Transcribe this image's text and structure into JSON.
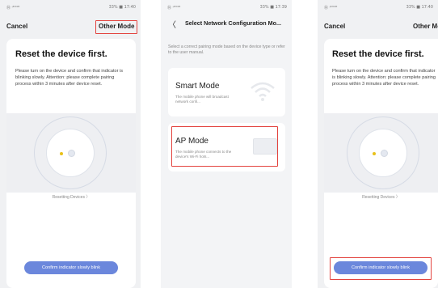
{
  "status": {
    "left": "Ⓝ ᵎ⁴ᴳ⁴ᴳ",
    "right_1": "33% ■ 17:40",
    "right_2": "33% ■ 17:39",
    "right_3": "33% ■ 17:40"
  },
  "reset_screen": {
    "cancel_label": "Cancel",
    "other_mode_label": "Other Mode",
    "title": "Reset the device first.",
    "description": "Please turn on the device and confirm that indicator is blinking slowly. Attention: please complete pairing process within 3 minutes after device reset.",
    "caption": "Resetting Devices 〉",
    "confirm_label": "Confirm indicator slowly blink"
  },
  "network_screen": {
    "back_label": "〈",
    "title": "Select Network Configuration Mo...",
    "hint": "Select a correct pairing mode based on the device type or refer to the user manual.",
    "smart_mode": {
      "title": "Smart Mode",
      "description": "The mobile phone will broadcast network confi..."
    },
    "ap_mode": {
      "title": "AP Mode",
      "description": "The mobile phone connects to the device's Wi-Fi hots..."
    }
  },
  "colors": {
    "accent": "#6b87dc",
    "highlight": "#e3443f",
    "led": "#e8c11a"
  }
}
